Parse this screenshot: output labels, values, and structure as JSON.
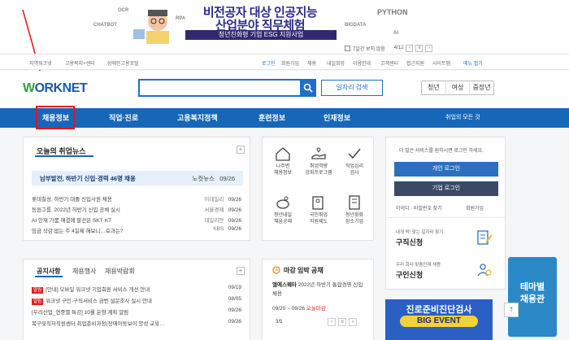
{
  "banner": {
    "words": [
      "OCR",
      "CHATBOT",
      "RPA",
      "BIGDATA",
      "AI"
    ],
    "title1": "비전공자 대상 인공지능",
    "title2": "산업분야 직무체험",
    "subtitle": "청년친화형 기업 ESG 지원사업",
    "python": "PYTHON",
    "hide_week": "7일간 보지 않음",
    "page": "4/12"
  },
  "util": {
    "left": [
      "지역워크넷",
      "고용복지+센터",
      "장애인고용포털"
    ],
    "right": [
      "로그인",
      "회원가입",
      "채용",
      "내일희망",
      "이용안내",
      "고객센터",
      "접근지원",
      "사이트맵"
    ],
    "all_menu": "메뉴 접기"
  },
  "header": {
    "logo_w": "W",
    "logo_rest": "ORKNET",
    "job_search": "일자리 검색",
    "toggles": [
      "청년",
      "여성",
      "중장년"
    ]
  },
  "nav": {
    "items": [
      "채용정보",
      "직업·진로",
      "고용복지정책",
      "훈련정보",
      "인재정보",
      "취업의 모든 것"
    ]
  },
  "news": {
    "title": "오늘의 취업뉴스",
    "highlight": {
      "text": "남부발전, 하반기 신입·경력 46명 채용",
      "source": "노컷뉴스",
      "date": "09/26"
    },
    "items": [
      {
        "text": "롯데칠성, 하반기 대졸 신입사원 채용",
        "source": "이데일리",
        "date": "09/26"
      },
      {
        "text": "동원그룹, 2022년 하반기 신입 공채 실시",
        "source": "서울경제",
        "date": "09/26"
      },
      {
        "text": "AI 인재 가뭄 해결에 팔걷은 SKT·KT",
        "source": "데일리안",
        "date": "09/26"
      },
      {
        "text": "임금 삭감 없는 주 4일제 해보니…효과는?",
        "source": "KBS",
        "date": "09/26"
      }
    ]
  },
  "notice": {
    "tabs": [
      "공지사항",
      "채용행사",
      "채용박람회"
    ],
    "badge": "알림",
    "items": [
      {
        "badge": true,
        "text": "[안내] 모바일 워크넷 기업회원 서비스 개선 안내",
        "date": "09/19"
      },
      {
        "badge": true,
        "text": "워크넷 구인·구직서비스 금번 설문조사 실시 안내",
        "date": "08/05"
      },
      {
        "badge": false,
        "text": "[우리산업_연중별 특강] 10월 운영 계획 알림",
        "date": "09/26"
      },
      {
        "badge": false,
        "text": "복구및직자직원센터 취업준비과정(장애아동보이 양성 교육…",
        "date": "09/26"
      }
    ]
  },
  "services": [
    {
      "line1": "나주변",
      "line2": "채용정보"
    },
    {
      "line1": "취업역량",
      "line2": "강화프로그램"
    },
    {
      "line1": "직업심리",
      "line2": "검사"
    },
    {
      "line1": "청년내일",
      "line2": "채움공제"
    },
    {
      "line1": "국민취업",
      "line2": "지원제도"
    },
    {
      "line1": "청년회화",
      "line2": "장소기업"
    }
  ],
  "deadline": {
    "title": "마감 임박 공채",
    "company": "엘에스웨타",
    "desc": "2022년 하반기 통합경영 신입 채용",
    "period": "09/20 ~ 09/26",
    "status": "오늘마감",
    "page": "3/5"
  },
  "login": {
    "intro": "더 많은 서비스를 원하시면 로그인 하세요.",
    "personal": "개인 로그인",
    "company": "기업 로그인",
    "find": "아이디 · 비밀번호 찾기",
    "join": "회원가입",
    "job_seek_small": "내게 딱! 맞는 일자리 찾기",
    "job_seek": "구직신청",
    "recruit_small": "우리 회사 맞춤인재 채용",
    "recruit": "구인신청"
  },
  "promo": {
    "line1": "진로준비진단검사",
    "line2": "BIG EVENT"
  },
  "float": {
    "line1": "테마별",
    "line2": "채용관",
    "top": "↑"
  }
}
